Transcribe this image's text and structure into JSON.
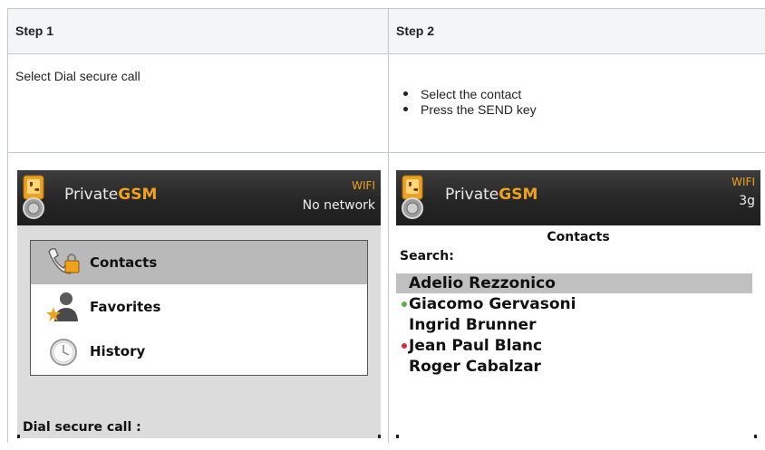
{
  "table": {
    "headers": [
      "Step 1",
      "Step 2"
    ],
    "step1_text": "Select Dial secure call",
    "step2_items": [
      "Select the contact",
      "Press the SEND key"
    ]
  },
  "screen1": {
    "brand_prefix": "Private",
    "brand_suffix": "GSM",
    "wifi": "WIFI",
    "network": "No network",
    "menu": [
      {
        "label": "Contacts",
        "icon": "phone-lock-icon",
        "selected": true
      },
      {
        "label": "Favorites",
        "icon": "person-star-icon",
        "selected": false
      },
      {
        "label": "History",
        "icon": "clock-icon",
        "selected": false
      }
    ],
    "footer_label": "Dial secure call :"
  },
  "screen2": {
    "brand_prefix": "Private",
    "brand_suffix": "GSM",
    "wifi": "WIFI",
    "network": "3g",
    "title": "Contacts",
    "search_label": "Search:",
    "contacts": [
      {
        "name": "Adelio Rezzonico",
        "selected": true,
        "status": "none"
      },
      {
        "name": "Giacomo Gervasoni",
        "selected": false,
        "status": "online"
      },
      {
        "name": "Ingrid Brunner",
        "selected": false,
        "status": "none"
      },
      {
        "name": "Jean Paul Blanc",
        "selected": false,
        "status": "busy"
      },
      {
        "name": "Roger Cabalzar",
        "selected": false,
        "status": "none"
      }
    ]
  },
  "colors": {
    "accent": "#f0a11c",
    "online": "#5fb24a",
    "busy": "#e0263a",
    "header_bg": "#f4f5f7",
    "border": "#c1c7d0"
  }
}
